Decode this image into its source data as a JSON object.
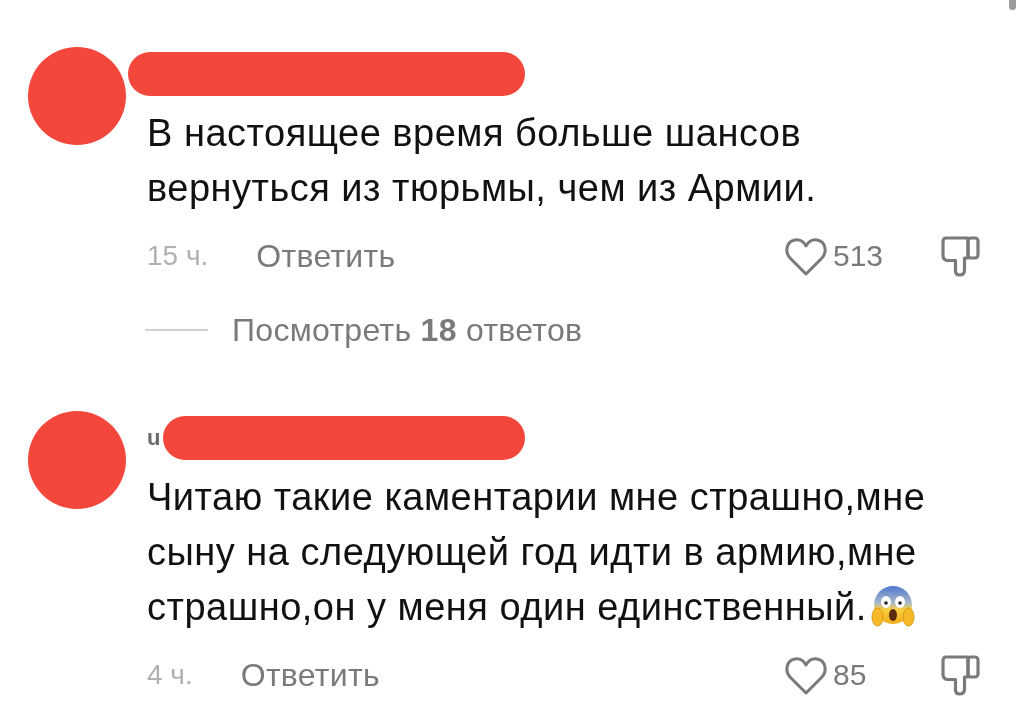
{
  "comments": [
    {
      "text": "В настоящее время больше шансов вернуться из тюрьмы, чем из Армии.",
      "emoji": false,
      "time": "15 ч.",
      "reply_label": "Ответить",
      "likes": "513",
      "liked": false,
      "disliked": false,
      "view_replies": "Посмотреть **18** ответов"
    },
    {
      "username": "u",
      "text": "Читаю такие каментарии мне страшно,мне сыну на следующей год идти в армию,мне страшно,он у меня один единственный.",
      "emoji": true,
      "time": "4 ч.",
      "reply_label": "Ответить",
      "likes": "85",
      "liked": false,
      "disliked": false
    }
  ]
}
